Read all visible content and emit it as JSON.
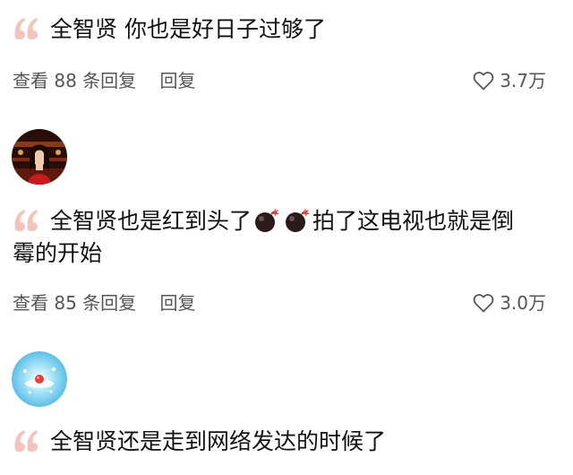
{
  "comments": [
    {
      "text": "全智贤 你也是好日子过够了",
      "view_replies": "查看 88 条回复",
      "reply_label": "回复",
      "likes": "3.7万"
    },
    {
      "text_before": "全智贤也是红到头了",
      "emoji": "bomb-emoji",
      "text_after_line1": "拍了这电视也就是倒",
      "text_line2": "霉的开始",
      "view_replies": "查看 85 条回复",
      "reply_label": "回复",
      "likes": "3.0万"
    },
    {
      "text": "全智贤还是走到网络发达的时候了"
    }
  ],
  "colors": {
    "quote_mark": "#f3c3bd",
    "meta_text": "#555555",
    "background": "#ffffff"
  }
}
